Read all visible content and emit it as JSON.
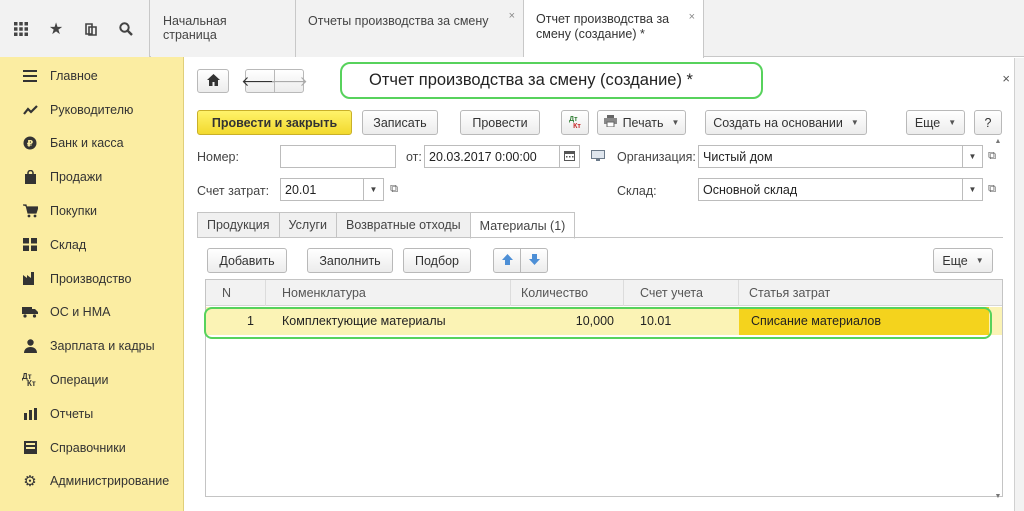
{
  "toolbar": {
    "icons": [
      "apps-grid-icon",
      "star-icon",
      "history-icon",
      "search-icon"
    ]
  },
  "tabs": [
    {
      "label": "Начальная страница"
    },
    {
      "label": "Отчеты производства за смену",
      "close": "×"
    },
    {
      "label": "Отчет производства за смену (создание) *",
      "close": "×"
    }
  ],
  "sidebar": {
    "items": [
      {
        "label": "Главное",
        "icon": "menu-lines-icon"
      },
      {
        "label": "Руководителю",
        "icon": "trend-chart-icon"
      },
      {
        "label": "Банк и касса",
        "icon": "ruble-coin-icon"
      },
      {
        "label": "Продажи",
        "icon": "shopping-bag-icon"
      },
      {
        "label": "Покупки",
        "icon": "shopping-cart-icon"
      },
      {
        "label": "Склад",
        "icon": "warehouse-grid-icon"
      },
      {
        "label": "Производство",
        "icon": "factory-icon"
      },
      {
        "label": "ОС и НМА",
        "icon": "truck-icon"
      },
      {
        "label": "Зарплата и кадры",
        "icon": "person-icon"
      },
      {
        "label": "Операции",
        "icon": "dt-kt-icon"
      },
      {
        "label": "Отчеты",
        "icon": "bar-chart-icon"
      },
      {
        "label": "Справочники",
        "icon": "book-icon"
      },
      {
        "label": "Администрирование",
        "icon": "gear-icon"
      }
    ]
  },
  "document": {
    "title": "Отчет производства за смену (создание) *",
    "close": "×"
  },
  "actions": {
    "post_and_close": "Провести и закрыть",
    "save": "Записать",
    "post": "Провести",
    "print": "Печать",
    "create_based_on": "Создать на основании",
    "more": "Еще",
    "help": "?",
    "dtkt": "Дт Кт"
  },
  "form": {
    "number_label": "Номер:",
    "number_value": "",
    "date_label": "от:",
    "date_value": "20.03.2017  0:00:00",
    "org_label": "Организация:",
    "org_value": "Чистый дом",
    "cost_account_label": "Счет затрат:",
    "cost_account_value": "20.01",
    "warehouse_label": "Склад:",
    "warehouse_value": "Основной склад"
  },
  "subtabs": [
    {
      "label": "Продукция"
    },
    {
      "label": "Услуги"
    },
    {
      "label": "Возвратные отходы"
    },
    {
      "label": "Материалы (1)"
    }
  ],
  "table_toolbar": {
    "add": "Добавить",
    "fill": "Заполнить",
    "select": "Подбор",
    "more": "Еще"
  },
  "table": {
    "columns": [
      "N",
      "Номенклатура",
      "Количество",
      "Счет учета",
      "Статья затрат"
    ],
    "rows": [
      {
        "n": "1",
        "item": "Комплектующие материалы",
        "qty": "10,000",
        "account": "10.01",
        "cost_item": "Списание материалов"
      }
    ]
  },
  "colors": {
    "sidebar_bg": "#fbeda2",
    "primary_button": "#f2d92e",
    "highlight_outline": "#57d25c",
    "selected_row": "#fbf3b5",
    "selected_cell": "#f4d31d"
  }
}
